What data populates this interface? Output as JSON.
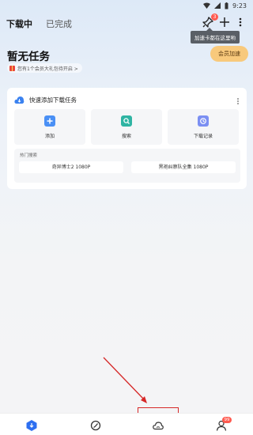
{
  "status_bar": {
    "time": "9:23"
  },
  "header": {
    "tabs": [
      {
        "label": "下载中",
        "active": true
      },
      {
        "label": "已完成",
        "active": false
      }
    ],
    "pin_badge": "3",
    "tooltip": "加速卡都在这里哟"
  },
  "main": {
    "empty_title": "暂无任务",
    "gift_text": "您有1个会员大礼包待开启 >",
    "vip_button": "会员加速"
  },
  "quick_add": {
    "title": "快速添加下载任务",
    "actions": [
      {
        "label": "添加",
        "icon": "plus-icon",
        "color": "#4a90f5"
      },
      {
        "label": "搜索",
        "icon": "search-icon",
        "color": "#2fb4a3"
      },
      {
        "label": "下载记录",
        "icon": "history-icon",
        "color": "#7b8ff2"
      }
    ],
    "hot_search": {
      "title": "热门搜索",
      "items": [
        "奇异博士2 1080P",
        "黑袍纠察队全集 1080P"
      ]
    }
  },
  "bottom_nav": {
    "items": [
      {
        "name": "download-icon",
        "active": true
      },
      {
        "name": "discover-icon",
        "active": false
      },
      {
        "name": "cloud-icon",
        "active": false
      },
      {
        "name": "profile-icon",
        "active": false
      }
    ],
    "profile_badge": "99"
  },
  "colors": {
    "accent": "#2d6ff0",
    "vip": "#f8c97c",
    "highlight": "#d62828"
  }
}
